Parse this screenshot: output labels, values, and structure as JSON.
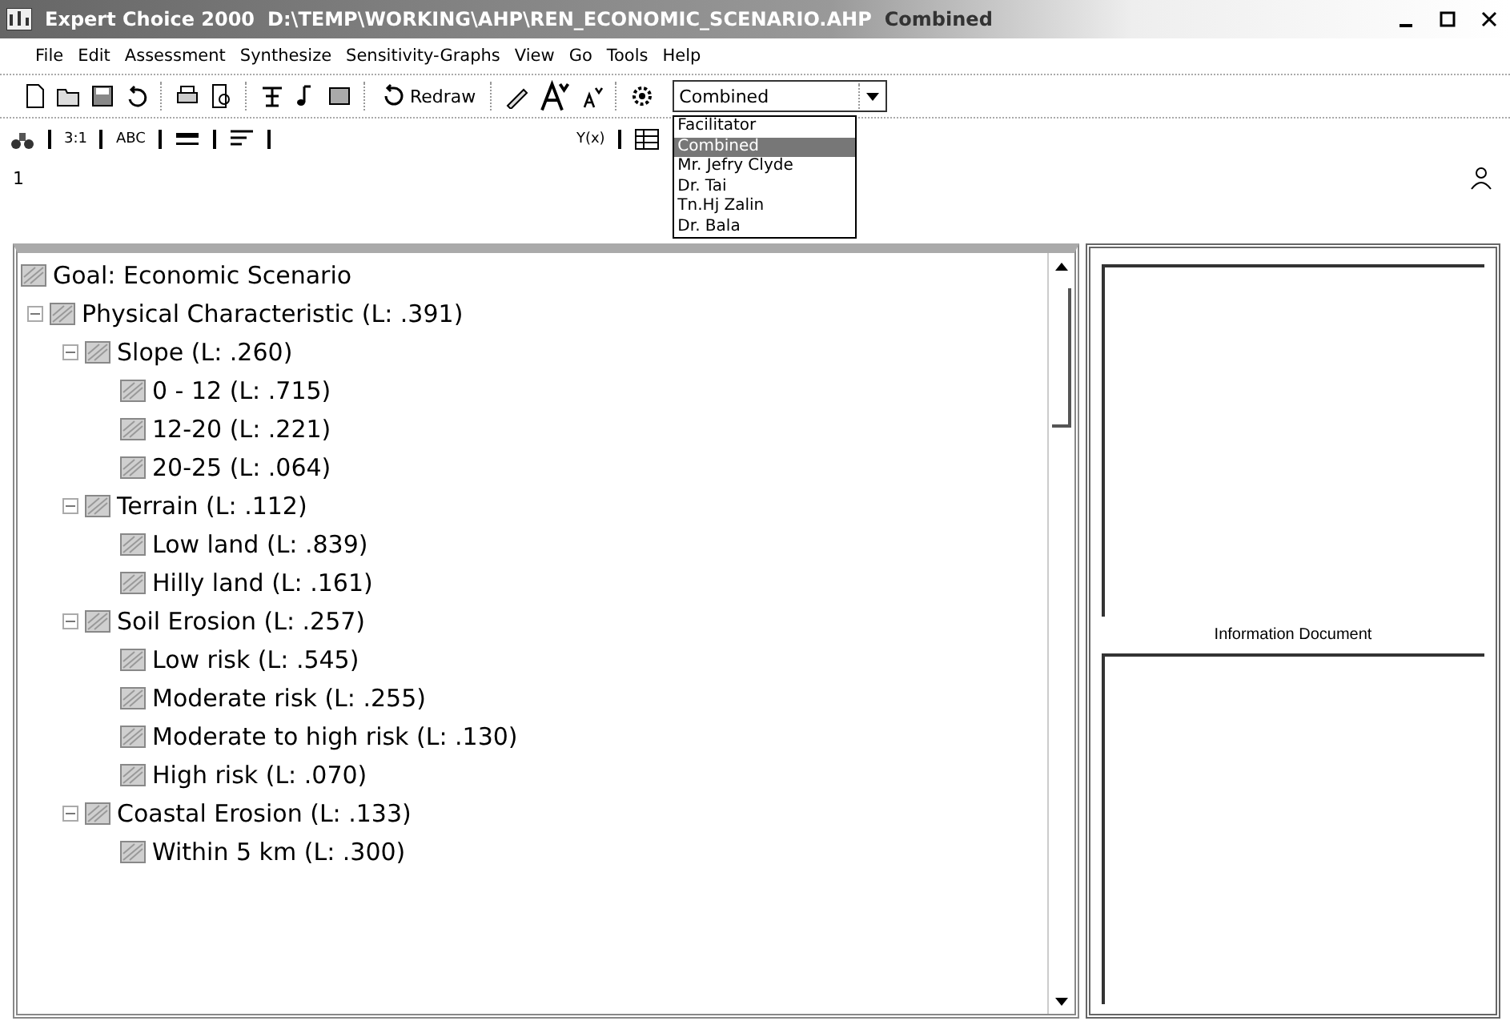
{
  "window": {
    "title": "Expert Choice 2000",
    "path": "D:\\TEMP\\WORKING\\AHP\\REN_ECONOMIC_SCENARIO.AHP",
    "mode": "Combined"
  },
  "menu": [
    "File",
    "Edit",
    "Assessment",
    "Synthesize",
    "Sensitivity-Graphs",
    "View",
    "Go",
    "Tools",
    "Help"
  ],
  "toolbar": {
    "redraw": "Redraw",
    "participant": {
      "value": "Combined",
      "expanded": true,
      "options": [
        {
          "label": "Facilitator",
          "selected": false
        },
        {
          "label": "Combined",
          "selected": true
        },
        {
          "label": "Mr. Jefry Clyde",
          "selected": false
        },
        {
          "label": "Dr. Tai",
          "selected": false
        },
        {
          "label": "Tn.Hj Zalin",
          "selected": false
        },
        {
          "label": "Dr. Bala",
          "selected": false
        }
      ]
    }
  },
  "toolbar2": {
    "ratio": "3:1",
    "abc": "ABC",
    "formula": "Y(x)"
  },
  "level_indicator": "1",
  "tree": {
    "label": "Goal: Economic Scenario",
    "children": [
      {
        "label": "Physical Characteristic (L: .391)",
        "expanded": true,
        "children": [
          {
            "label": "Slope (L: .260)",
            "expanded": true,
            "children": [
              {
                "label": "0 - 12 (L: .715)"
              },
              {
                "label": "12-20 (L: .221)"
              },
              {
                "label": "20-25 (L: .064)"
              }
            ]
          },
          {
            "label": "Terrain (L: .112)",
            "expanded": true,
            "children": [
              {
                "label": "Low land (L: .839)"
              },
              {
                "label": "Hilly land (L: .161)"
              }
            ]
          },
          {
            "label": "Soil Erosion (L: .257)",
            "expanded": true,
            "children": [
              {
                "label": "Low risk (L: .545)"
              },
              {
                "label": "Moderate risk (L: .255)"
              },
              {
                "label": "Moderate to high risk (L: .130)"
              },
              {
                "label": "High risk (L: .070)"
              }
            ]
          },
          {
            "label": "Coastal Erosion (L: .133)",
            "expanded": true,
            "children": [
              {
                "label": "Within 5 km (L: .300)"
              }
            ]
          }
        ]
      }
    ]
  },
  "info_panel": {
    "caption": "Information Document"
  }
}
